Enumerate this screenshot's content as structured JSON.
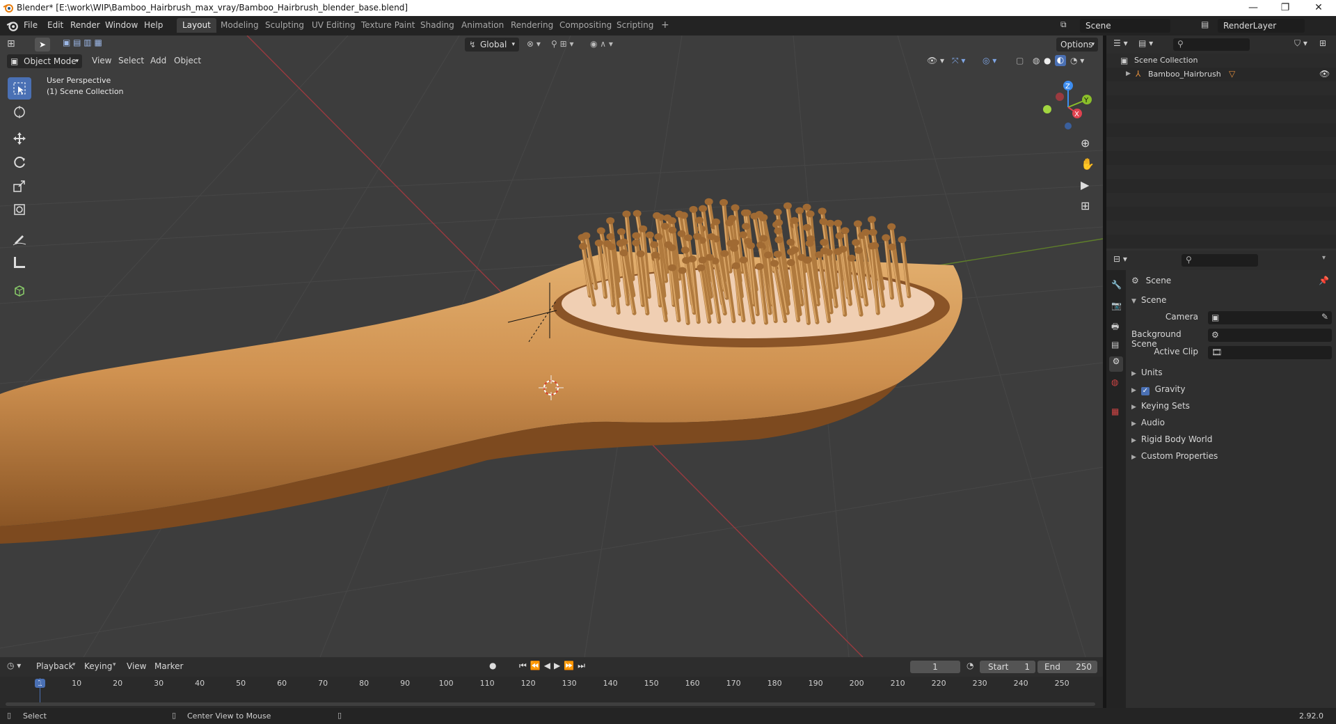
{
  "window": {
    "title": "Blender* [E:\\work\\WIP\\Bamboo_Hairbrush_max_vray/Bamboo_Hairbrush_blender_base.blend]",
    "controls": [
      "—",
      "❐",
      "✕"
    ]
  },
  "menu": {
    "items": [
      "File",
      "Edit",
      "Render",
      "Window",
      "Help"
    ],
    "workspaces": [
      "Layout",
      "Modeling",
      "Sculpting",
      "UV Editing",
      "Texture Paint",
      "Shading",
      "Animation",
      "Rendering",
      "Compositing",
      "Scripting",
      "+"
    ],
    "active_workspace": "Layout",
    "scene_name": "Scene",
    "view_layer": "RenderLayer"
  },
  "viewport_header": {
    "orientation": "Global",
    "options_label": "Options",
    "mode": "Object Mode",
    "menus": [
      "View",
      "Select",
      "Add",
      "Object"
    ]
  },
  "viewport": {
    "overlay_line1": "User Perspective",
    "overlay_line2": "(1) Scene Collection",
    "gizmo_labels": {
      "z": "Z",
      "y": "Y",
      "x": "X"
    }
  },
  "outliner": {
    "root": "Scene Collection",
    "items": [
      {
        "name": "Bamboo_Hairbrush"
      }
    ]
  },
  "properties": {
    "context": "Scene",
    "panel_title": "Scene",
    "fields": [
      {
        "label": "Camera",
        "value": ""
      },
      {
        "label": "Background Scene",
        "value": ""
      },
      {
        "label": "Active Clip",
        "value": ""
      }
    ],
    "sections": [
      "Units",
      "Gravity",
      "Keying Sets",
      "Audio",
      "Rigid Body World",
      "Custom Properties"
    ],
    "gravity_checked": true
  },
  "timeline": {
    "menus": [
      "Playback",
      "Keying",
      "View",
      "Marker"
    ],
    "current_frame": "1",
    "start_label": "Start",
    "start": "1",
    "end_label": "End",
    "end": "250",
    "ticks": [
      "1",
      "10",
      "20",
      "30",
      "40",
      "50",
      "60",
      "70",
      "80",
      "90",
      "100",
      "110",
      "120",
      "130",
      "140",
      "150",
      "160",
      "170",
      "180",
      "190",
      "200",
      "210",
      "220",
      "230",
      "240",
      "250"
    ]
  },
  "status": {
    "left": "Select",
    "middle": "Center View to Mouse",
    "version": "2.92.0"
  },
  "colors": {
    "accent": "#4a70b4",
    "axis_x": "#e0424f",
    "axis_y": "#8bbf2a",
    "axis_z": "#3d8df0",
    "wood": "#c98b4c"
  }
}
